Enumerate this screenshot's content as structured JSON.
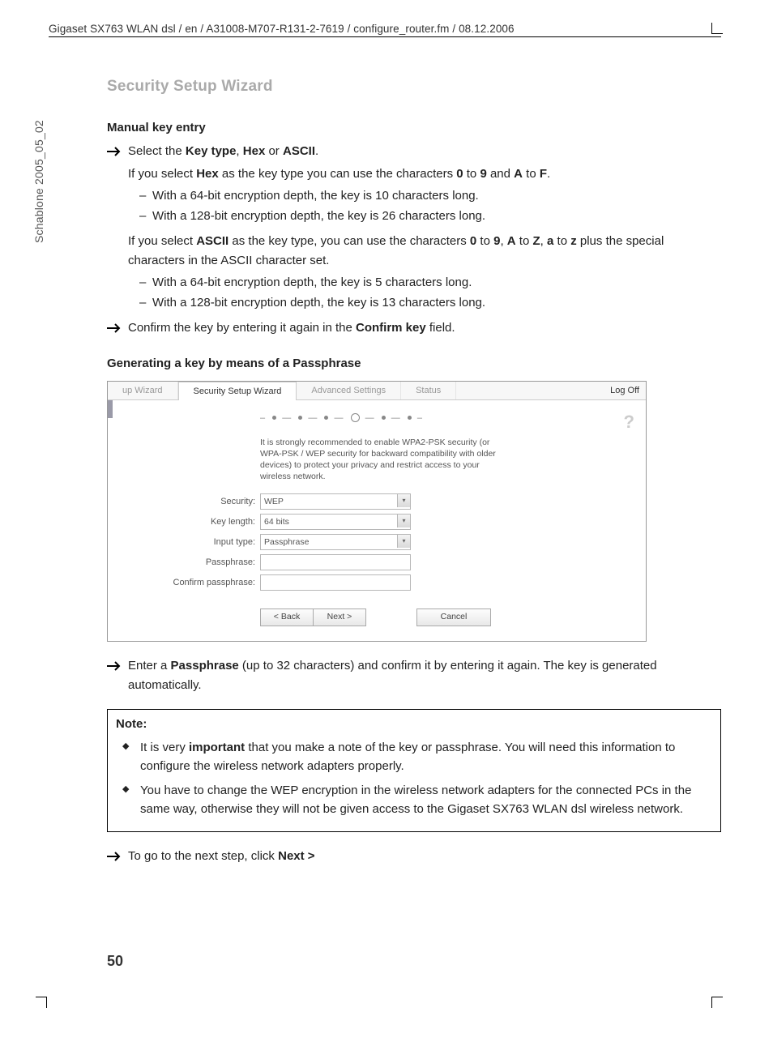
{
  "header_path": "Gigaset SX763 WLAN dsl / en / A31008-M707-R131-2-7619 / configure_router.fm / 08.12.2006",
  "vertical_label": "Schablone 2005_05_02",
  "section_title": "Security Setup Wizard",
  "manual_key_heading": "Manual key entry",
  "step_select_keytype_pre": "Select the ",
  "step_select_keytype_b1": "Key type",
  "step_select_keytype_mid1": ", ",
  "step_select_keytype_b2": "Hex",
  "step_select_keytype_mid2": " or ",
  "step_select_keytype_b3": "ASCII",
  "step_select_keytype_post": ".",
  "hex_line_pre": "If you select ",
  "hex_line_b": "Hex",
  "hex_line_mid": " as the key type you can use the characters ",
  "hex_line_b2": "0",
  "hex_line_to1": " to ",
  "hex_line_b3": "9",
  "hex_line_and": " and ",
  "hex_line_b4": "A",
  "hex_line_to2": " to ",
  "hex_line_b5": "F",
  "hex_line_post": ".",
  "hex_bullets": [
    "With a 64-bit encryption depth, the key is 10 characters long.",
    "With a 128-bit encryption depth, the key is 26 characters long."
  ],
  "ascii_line_pre": "If you select ",
  "ascii_line_b": "ASCII",
  "ascii_line_mid": " as the key type, you can use the characters ",
  "ascii_line_b2": "0",
  "ascii_line_to1": " to ",
  "ascii_line_b3": "9",
  "ascii_line_c1": ", ",
  "ascii_line_b4": "A",
  "ascii_line_to2": " to ",
  "ascii_line_b5": "Z",
  "ascii_line_c2": ", ",
  "ascii_line_b6": "a",
  "ascii_line_to3": " to ",
  "ascii_line_b7": "z",
  "ascii_line_post": " plus the special characters in the ASCII character set.",
  "ascii_bullets": [
    "With a 64-bit encryption depth, the key is 5 characters long.",
    "With a 128-bit encryption depth, the key is 13 characters long."
  ],
  "confirm_line_pre": "Confirm the key by entering it again in the ",
  "confirm_line_b": "Confirm key",
  "confirm_line_post": " field.",
  "passphrase_heading": "Generating a key by means of a Passphrase",
  "router": {
    "tabs": [
      "up Wizard",
      "Security Setup Wizard",
      "Advanced Settings",
      "Status"
    ],
    "logoff": "Log Off",
    "info_text": "It is strongly recommended to enable WPA2-PSK security (or WPA-PSK / WEP security for backward compatibility with older devices) to protect your privacy and restrict access to your wireless network.",
    "labels": {
      "security": "Security:",
      "keylen": "Key length:",
      "inputtype": "Input type:",
      "pass": "Passphrase:",
      "confirm": "Confirm passphrase:"
    },
    "values": {
      "security": "WEP",
      "keylen": "64 bits",
      "inputtype": "Passphrase"
    },
    "buttons": {
      "back": "< Back",
      "next": "Next >",
      "cancel": "Cancel"
    },
    "help": "?"
  },
  "enter_pass_pre": "Enter a ",
  "enter_pass_b": "Passphrase",
  "enter_pass_post": " (up to 32 characters) and confirm it by entering it again. The key is generated automatically.",
  "note_title": "Note:",
  "note1_pre": "It is very ",
  "note1_b": "important",
  "note1_post": " that you make a note of the key or passphrase. You will need this information to configure the wireless network adapters properly.",
  "note2": "You have to change the WEP encryption in the wireless network adapters for the connected PCs in the same way, otherwise they will not be given access to the Gigaset SX763 WLAN dsl wireless network.",
  "goto_next_pre": "To go to the next step, click ",
  "goto_next_b": "Next >",
  "page_number": "50"
}
